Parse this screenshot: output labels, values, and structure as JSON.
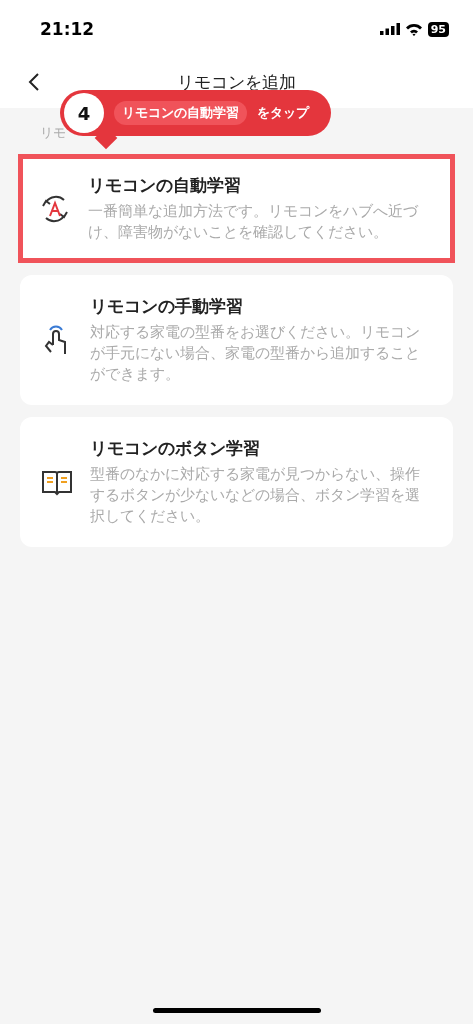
{
  "status_bar": {
    "time": "21:12",
    "battery": "95"
  },
  "nav": {
    "title": "リモコンを追加"
  },
  "subtitle": "リモ",
  "callout": {
    "step": "4",
    "chip": "リモコンの自動学習",
    "action": "をタップ"
  },
  "methods": [
    {
      "kind": "auto",
      "title": "リモコンの自動学習",
      "description": "一番簡単な追加方法です。リモコンをハブへ近づけ、障害物がないことを確認してください。",
      "highlighted": true
    },
    {
      "kind": "manual",
      "title": "リモコンの手動学習",
      "description": "対応する家電の型番をお選びください。リモコンが手元にない場合、家電の型番から追加することができます。",
      "highlighted": false
    },
    {
      "kind": "button",
      "title": "リモコンのボタン学習",
      "description": "型番のなかに対応する家電が見つからない、操作するボタンが少ないなどの場合、ボタン学習を選択してください。",
      "highlighted": false
    }
  ]
}
